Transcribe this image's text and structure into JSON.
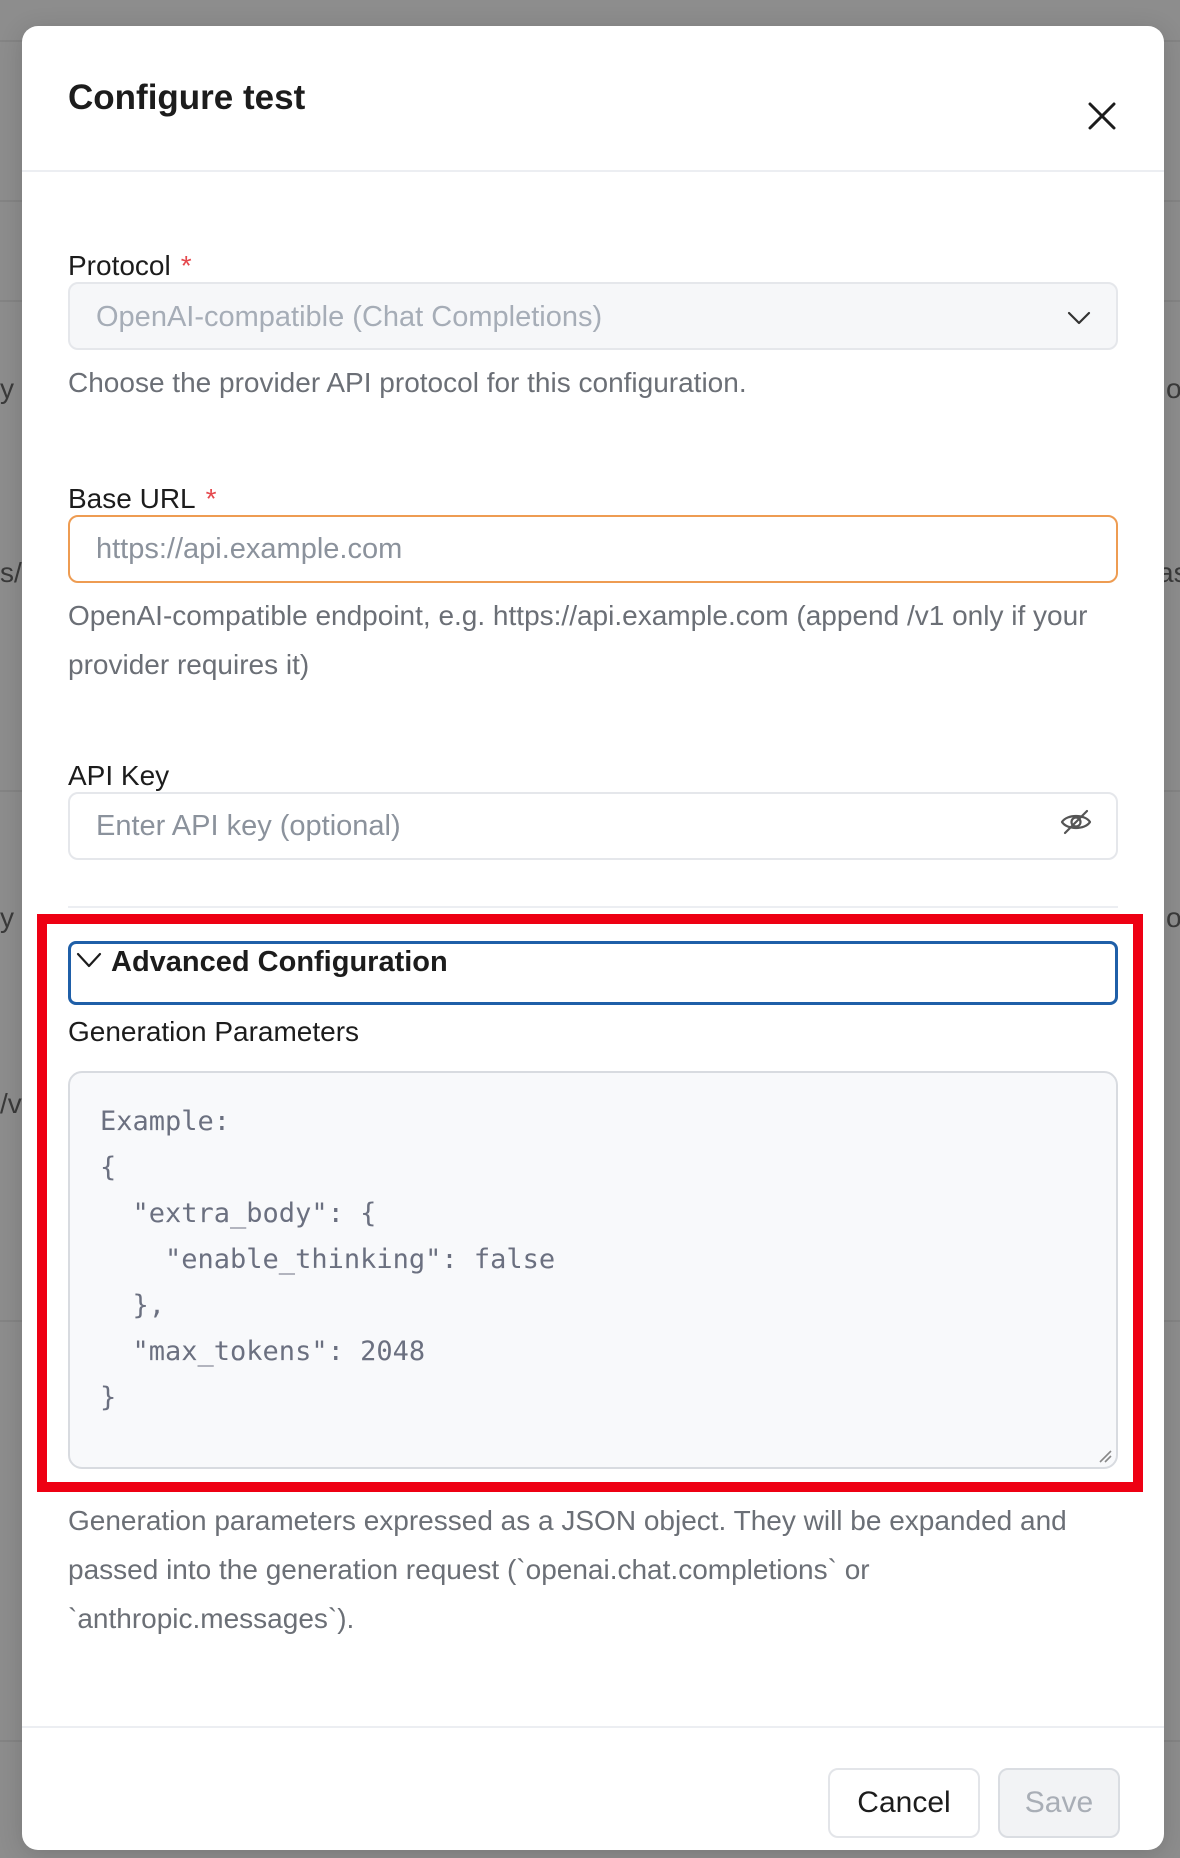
{
  "modal": {
    "title": "Configure test",
    "close_icon": "close-icon"
  },
  "protocol": {
    "label": "Protocol",
    "required_mark": "*",
    "value": "OpenAI-compatible (Chat Completions)",
    "help": "Choose the provider API protocol for this configuration."
  },
  "base_url": {
    "label": "Base URL",
    "required_mark": "*",
    "placeholder": "https://api.example.com",
    "value": "",
    "help": "OpenAI-compatible endpoint, e.g. https://api.example.com (append /v1 only if your provider requires it)"
  },
  "api_key": {
    "label": "API Key",
    "placeholder": "Enter API key (optional)",
    "value": "",
    "toggle_icon": "eye-off-icon"
  },
  "advanced": {
    "toggle_label": "Advanced Configuration",
    "expanded": true,
    "generation_params": {
      "label": "Generation Parameters",
      "placeholder": "Example:\n{\n  \"extra_body\": {\n    \"enable_thinking\": false\n  },\n  \"max_tokens\": 2048\n}",
      "help": "Generation parameters expressed as a JSON object. They will be expanded and passed into the generation request (`openai.chat.completions` or `anthropic.messages`)."
    }
  },
  "footer": {
    "cancel_label": "Cancel",
    "save_label": "Save"
  },
  "background": {
    "fragments": [
      "y (",
      "s/",
      "y (",
      "/v",
      "o",
      "as",
      "o"
    ]
  },
  "colors": {
    "required": "#e5484d",
    "focus_border": "#ee9c52",
    "toggle_focus": "#1f5fa8",
    "highlight": "#ee0013"
  }
}
